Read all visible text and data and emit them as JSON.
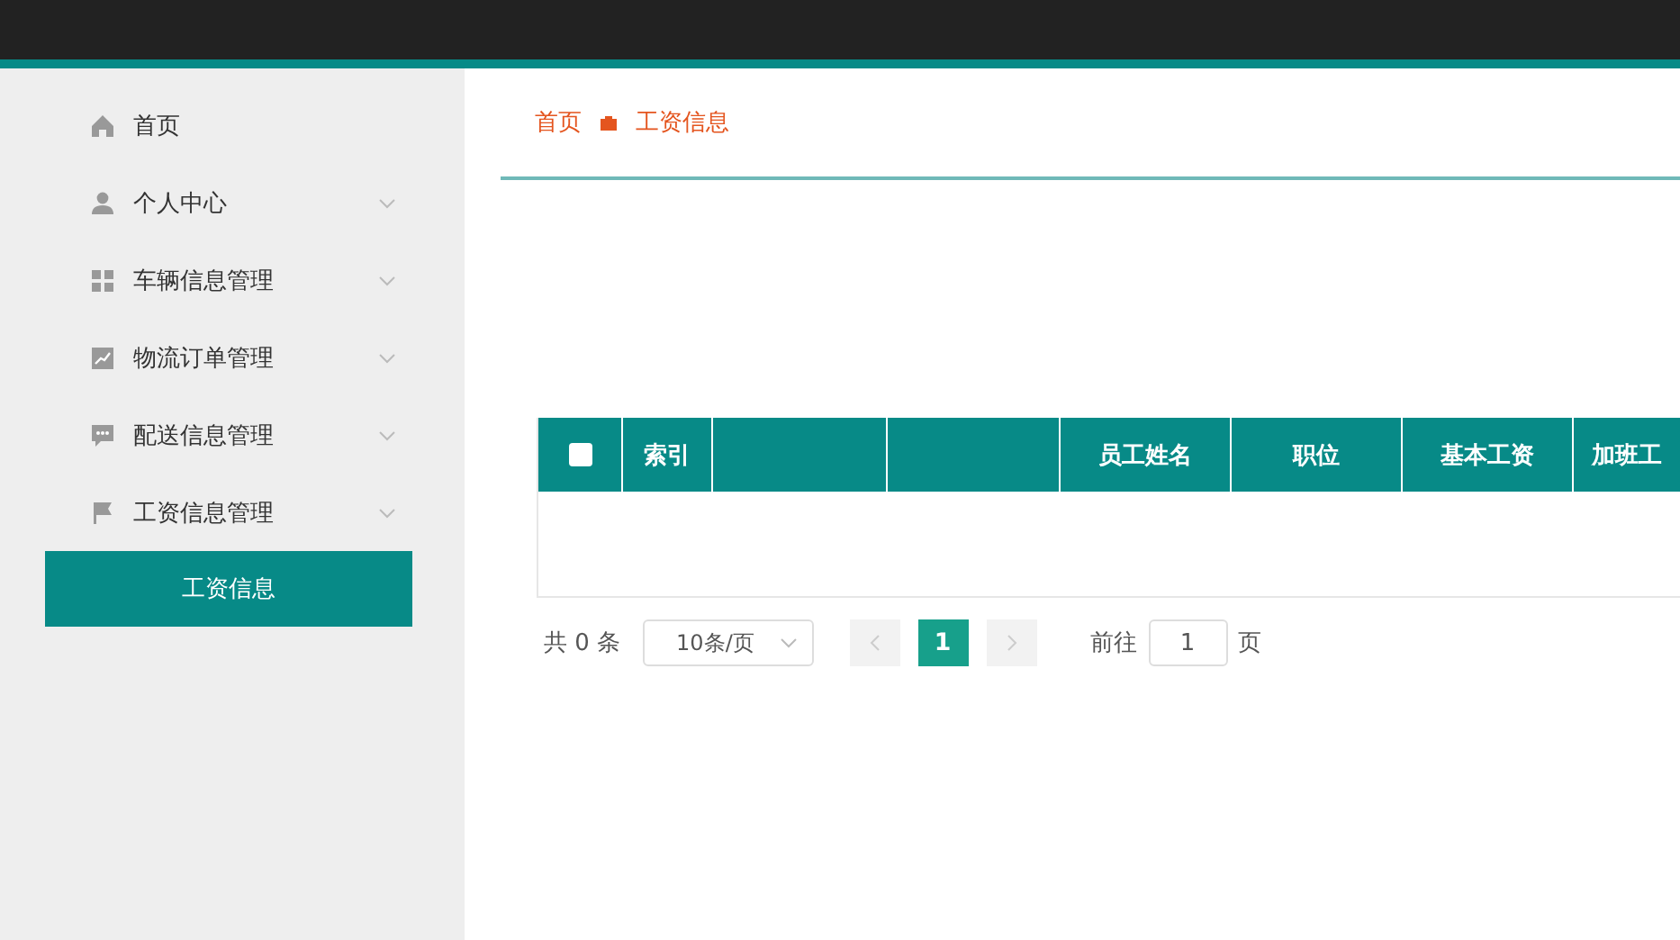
{
  "sidebar": {
    "items": [
      {
        "label": "首页",
        "expandable": false
      },
      {
        "label": "个人中心",
        "expandable": true
      },
      {
        "label": "车辆信息管理",
        "expandable": true
      },
      {
        "label": "物流订单管理",
        "expandable": true
      },
      {
        "label": "配送信息管理",
        "expandable": true
      },
      {
        "label": "工资信息管理",
        "expandable": true,
        "children": [
          {
            "label": "工资信息",
            "selected": true
          }
        ]
      }
    ]
  },
  "breadcrumb": [
    "首页",
    "工资信息"
  ],
  "table": {
    "select_all_checked": false,
    "columns": [
      {
        "label": "索引"
      },
      {},
      {},
      {
        "label": "员工姓名"
      },
      {
        "label": "职位"
      },
      {
        "label": "基本工资"
      },
      {
        "label": "加班工"
      }
    ]
  },
  "pagination": {
    "total": "共 0 条",
    "page_size": "10条/页",
    "pages": [
      {
        "label": "1",
        "selected": true
      }
    ],
    "goto_label": "前往",
    "goto_value": "1",
    "goto_suffix": "页"
  }
}
